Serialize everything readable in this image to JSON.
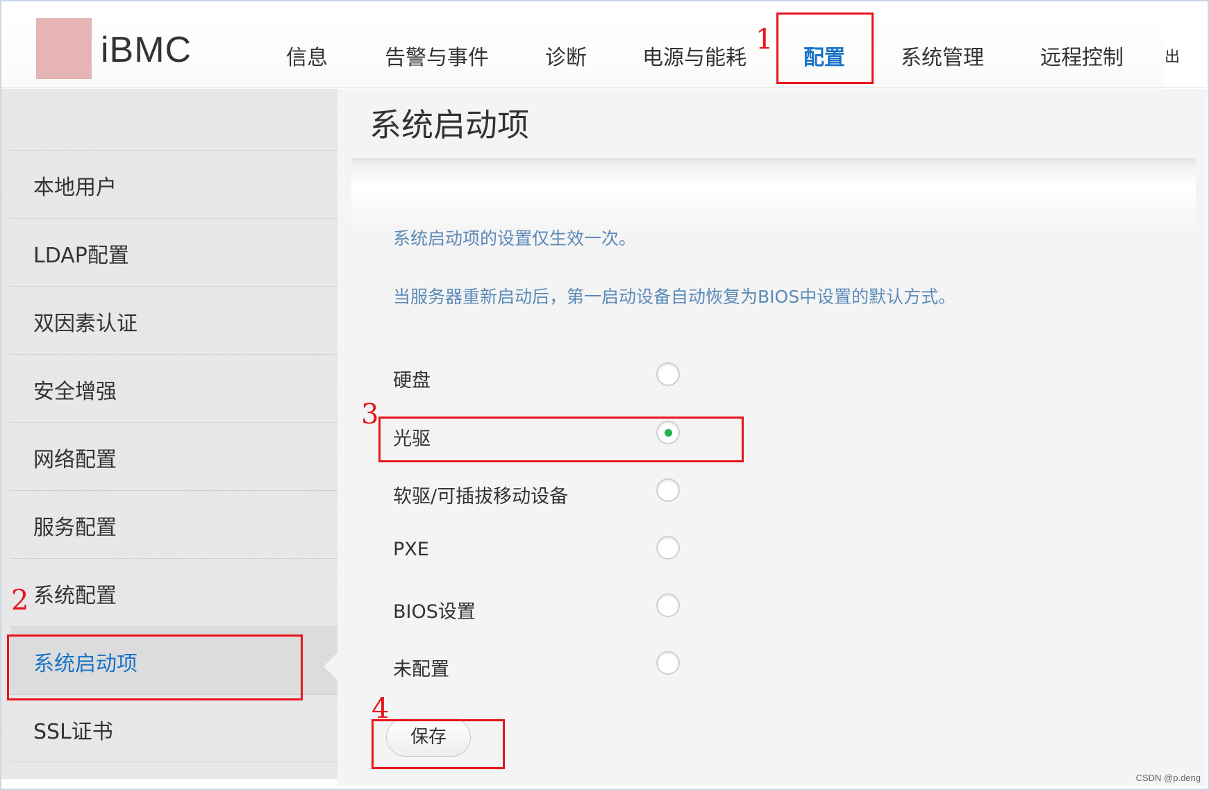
{
  "app": {
    "logo_text": "iBMC"
  },
  "nav": {
    "items": [
      {
        "label": "信息"
      },
      {
        "label": "告警与事件"
      },
      {
        "label": "诊断"
      },
      {
        "label": "电源与能耗"
      },
      {
        "label": "配置",
        "active": true
      },
      {
        "label": "系统管理"
      },
      {
        "label": "远程控制"
      },
      {
        "label": "出"
      }
    ]
  },
  "sidebar": {
    "items": [
      {
        "label": "本地用户"
      },
      {
        "label": "LDAP配置"
      },
      {
        "label": "双因素认证"
      },
      {
        "label": "安全增强"
      },
      {
        "label": "网络配置"
      },
      {
        "label": "服务配置"
      },
      {
        "label": "系统配置"
      },
      {
        "label": "系统启动项",
        "active": true
      },
      {
        "label": "SSL证书"
      }
    ]
  },
  "main": {
    "title": "系统启动项",
    "notes": [
      "系统启动项的设置仅生效一次。",
      "当服务器重新启动后，第一启动设备自动恢复为BIOS中设置的默认方式。"
    ],
    "boot_options": [
      {
        "label": "硬盘",
        "checked": false
      },
      {
        "label": "光驱",
        "checked": true
      },
      {
        "label": "软驱/可插拔移动设备",
        "checked": false
      },
      {
        "label": "PXE",
        "checked": false
      },
      {
        "label": "BIOS设置",
        "checked": false
      },
      {
        "label": "未配置",
        "checked": false
      }
    ],
    "save_label": "保存"
  },
  "annotations": [
    "1",
    "2",
    "3",
    "4"
  ],
  "credit": "CSDN @p.deng",
  "colors": {
    "accent": "#1a73c8",
    "note_text": "#5b8ab8",
    "radio_selected": "#22b24c",
    "annotation_red": "#e8141c"
  }
}
